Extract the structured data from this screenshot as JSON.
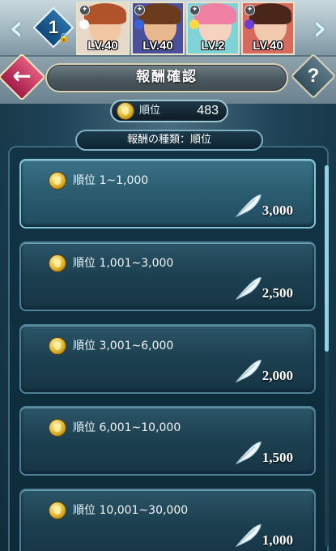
{
  "team": {
    "number": "1"
  },
  "party": [
    {
      "level": "LV.40",
      "hair": "#b0522a",
      "skin": "#f2c7a4",
      "bg": "#e7d9c9",
      "stat": "#ffffff"
    },
    {
      "level": "LV.40",
      "hair": "#6b3b1e",
      "skin": "#e8b88f",
      "bg": "#4c4f9b",
      "stat": "#3b64d6"
    },
    {
      "level": "LV.2",
      "hair": "#ef7fa3",
      "skin": "#f6d3c0",
      "bg": "#7fd3d6",
      "stat": "#ffd84a"
    },
    {
      "level": "LV.40",
      "hair": "#4a2519",
      "skin": "#f1c9ae",
      "bg": "#d66a5c",
      "stat": "#6a3fd0"
    }
  ],
  "header": {
    "title": "報酬確認"
  },
  "rank": {
    "label": "順位",
    "value": "483"
  },
  "reward_type": "報酬の種類：順位",
  "rewards": [
    {
      "label": "順位 1~1,000",
      "amount": "3,000"
    },
    {
      "label": "順位 1,001~3,000",
      "amount": "2,500"
    },
    {
      "label": "順位 3,001~6,000",
      "amount": "2,000"
    },
    {
      "label": "順位 6,001~10,000",
      "amount": "1,500"
    },
    {
      "label": "順位 10,001~30,000",
      "amount": "1,000"
    }
  ],
  "colors": {
    "accent": "#82c4d8",
    "medal": "#e0b22c",
    "back": "#c73463"
  },
  "icons": {
    "reward": "feather-icon",
    "rank": "medal-icon"
  }
}
